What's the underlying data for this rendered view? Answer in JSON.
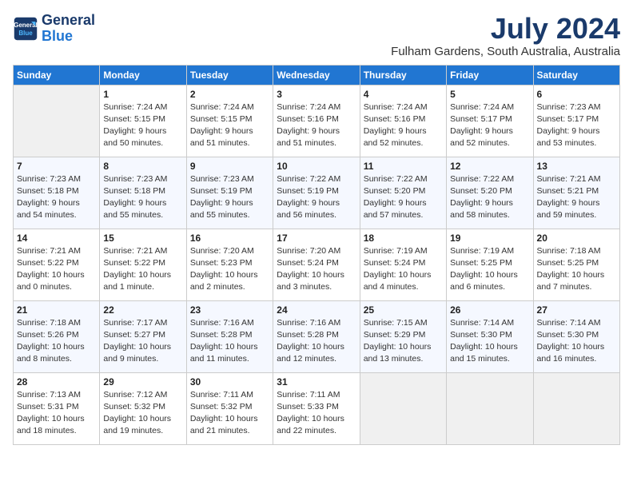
{
  "logo": {
    "line1": "General",
    "line2": "Blue"
  },
  "title": "July 2024",
  "location": "Fulham Gardens, South Australia, Australia",
  "weekdays": [
    "Sunday",
    "Monday",
    "Tuesday",
    "Wednesday",
    "Thursday",
    "Friday",
    "Saturday"
  ],
  "weeks": [
    [
      {
        "day": "",
        "info": ""
      },
      {
        "day": "1",
        "info": "Sunrise: 7:24 AM\nSunset: 5:15 PM\nDaylight: 9 hours\nand 50 minutes."
      },
      {
        "day": "2",
        "info": "Sunrise: 7:24 AM\nSunset: 5:15 PM\nDaylight: 9 hours\nand 51 minutes."
      },
      {
        "day": "3",
        "info": "Sunrise: 7:24 AM\nSunset: 5:16 PM\nDaylight: 9 hours\nand 51 minutes."
      },
      {
        "day": "4",
        "info": "Sunrise: 7:24 AM\nSunset: 5:16 PM\nDaylight: 9 hours\nand 52 minutes."
      },
      {
        "day": "5",
        "info": "Sunrise: 7:24 AM\nSunset: 5:17 PM\nDaylight: 9 hours\nand 52 minutes."
      },
      {
        "day": "6",
        "info": "Sunrise: 7:23 AM\nSunset: 5:17 PM\nDaylight: 9 hours\nand 53 minutes."
      }
    ],
    [
      {
        "day": "7",
        "info": "Sunrise: 7:23 AM\nSunset: 5:18 PM\nDaylight: 9 hours\nand 54 minutes."
      },
      {
        "day": "8",
        "info": "Sunrise: 7:23 AM\nSunset: 5:18 PM\nDaylight: 9 hours\nand 55 minutes."
      },
      {
        "day": "9",
        "info": "Sunrise: 7:23 AM\nSunset: 5:19 PM\nDaylight: 9 hours\nand 55 minutes."
      },
      {
        "day": "10",
        "info": "Sunrise: 7:22 AM\nSunset: 5:19 PM\nDaylight: 9 hours\nand 56 minutes."
      },
      {
        "day": "11",
        "info": "Sunrise: 7:22 AM\nSunset: 5:20 PM\nDaylight: 9 hours\nand 57 minutes."
      },
      {
        "day": "12",
        "info": "Sunrise: 7:22 AM\nSunset: 5:20 PM\nDaylight: 9 hours\nand 58 minutes."
      },
      {
        "day": "13",
        "info": "Sunrise: 7:21 AM\nSunset: 5:21 PM\nDaylight: 9 hours\nand 59 minutes."
      }
    ],
    [
      {
        "day": "14",
        "info": "Sunrise: 7:21 AM\nSunset: 5:22 PM\nDaylight: 10 hours\nand 0 minutes."
      },
      {
        "day": "15",
        "info": "Sunrise: 7:21 AM\nSunset: 5:22 PM\nDaylight: 10 hours\nand 1 minute."
      },
      {
        "day": "16",
        "info": "Sunrise: 7:20 AM\nSunset: 5:23 PM\nDaylight: 10 hours\nand 2 minutes."
      },
      {
        "day": "17",
        "info": "Sunrise: 7:20 AM\nSunset: 5:24 PM\nDaylight: 10 hours\nand 3 minutes."
      },
      {
        "day": "18",
        "info": "Sunrise: 7:19 AM\nSunset: 5:24 PM\nDaylight: 10 hours\nand 4 minutes."
      },
      {
        "day": "19",
        "info": "Sunrise: 7:19 AM\nSunset: 5:25 PM\nDaylight: 10 hours\nand 6 minutes."
      },
      {
        "day": "20",
        "info": "Sunrise: 7:18 AM\nSunset: 5:25 PM\nDaylight: 10 hours\nand 7 minutes."
      }
    ],
    [
      {
        "day": "21",
        "info": "Sunrise: 7:18 AM\nSunset: 5:26 PM\nDaylight: 10 hours\nand 8 minutes."
      },
      {
        "day": "22",
        "info": "Sunrise: 7:17 AM\nSunset: 5:27 PM\nDaylight: 10 hours\nand 9 minutes."
      },
      {
        "day": "23",
        "info": "Sunrise: 7:16 AM\nSunset: 5:28 PM\nDaylight: 10 hours\nand 11 minutes."
      },
      {
        "day": "24",
        "info": "Sunrise: 7:16 AM\nSunset: 5:28 PM\nDaylight: 10 hours\nand 12 minutes."
      },
      {
        "day": "25",
        "info": "Sunrise: 7:15 AM\nSunset: 5:29 PM\nDaylight: 10 hours\nand 13 minutes."
      },
      {
        "day": "26",
        "info": "Sunrise: 7:14 AM\nSunset: 5:30 PM\nDaylight: 10 hours\nand 15 minutes."
      },
      {
        "day": "27",
        "info": "Sunrise: 7:14 AM\nSunset: 5:30 PM\nDaylight: 10 hours\nand 16 minutes."
      }
    ],
    [
      {
        "day": "28",
        "info": "Sunrise: 7:13 AM\nSunset: 5:31 PM\nDaylight: 10 hours\nand 18 minutes."
      },
      {
        "day": "29",
        "info": "Sunrise: 7:12 AM\nSunset: 5:32 PM\nDaylight: 10 hours\nand 19 minutes."
      },
      {
        "day": "30",
        "info": "Sunrise: 7:11 AM\nSunset: 5:32 PM\nDaylight: 10 hours\nand 21 minutes."
      },
      {
        "day": "31",
        "info": "Sunrise: 7:11 AM\nSunset: 5:33 PM\nDaylight: 10 hours\nand 22 minutes."
      },
      {
        "day": "",
        "info": ""
      },
      {
        "day": "",
        "info": ""
      },
      {
        "day": "",
        "info": ""
      }
    ]
  ]
}
